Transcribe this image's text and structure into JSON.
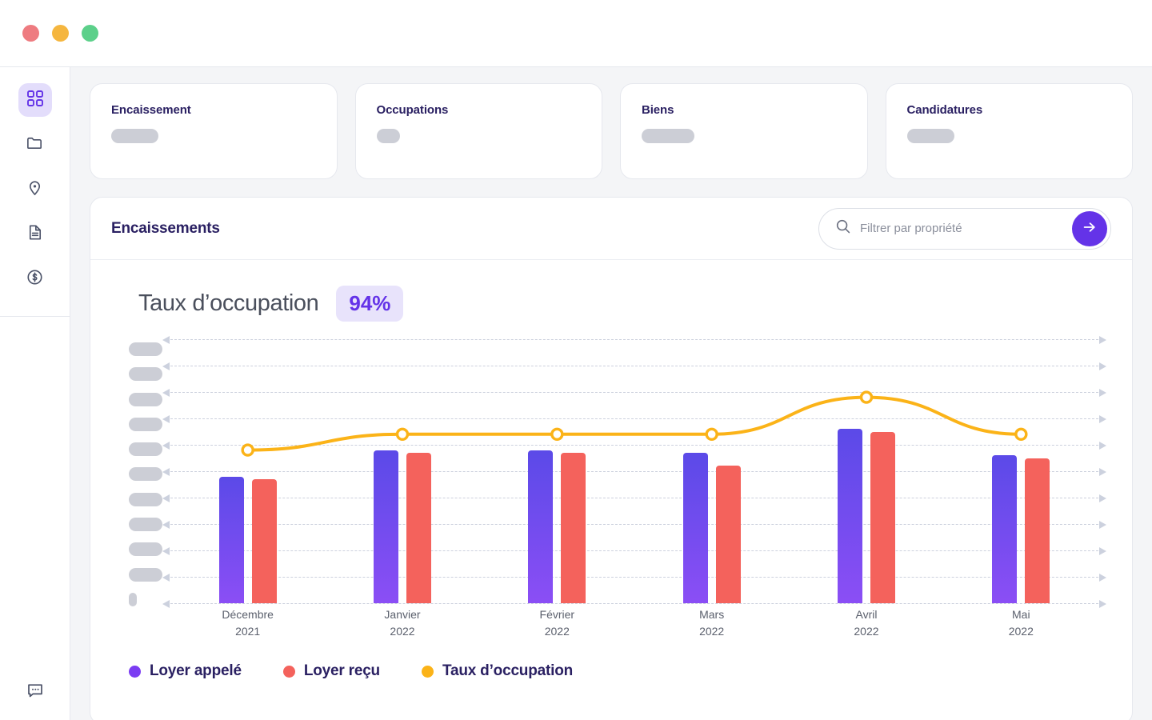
{
  "window": {
    "dots": [
      {
        "name": "close",
        "color": "#ee7b80"
      },
      {
        "name": "minimize",
        "color": "#f5b63f"
      },
      {
        "name": "maximize",
        "color": "#5cd08a"
      }
    ]
  },
  "sidebar": {
    "items": [
      {
        "icon": "dashboard-grid-icon",
        "active": true
      },
      {
        "icon": "folder-icon",
        "active": false
      },
      {
        "icon": "location-pin-icon",
        "active": false
      },
      {
        "icon": "document-icon",
        "active": false
      },
      {
        "icon": "dollar-circle-icon",
        "active": false
      }
    ],
    "footer": {
      "icon": "chat-bubble-icon"
    }
  },
  "kpi_cards": [
    {
      "title": "Encaissement",
      "skeleton_width": 59
    },
    {
      "title": "Occupations",
      "skeleton_width": 29
    },
    {
      "title": "Biens",
      "skeleton_width": 66
    },
    {
      "title": "Candidatures",
      "skeleton_width": 59
    }
  ],
  "panel": {
    "title": "Encaissements",
    "search": {
      "placeholder": "Filtrer par propriété",
      "value": "",
      "icon": "search-icon",
      "submit_icon": "arrow-right-icon",
      "accent": "#6433e8"
    }
  },
  "chart_header": {
    "label": "Taux d’occupation",
    "rate": "94%"
  },
  "legend": [
    {
      "label": "Loyer appelé",
      "color": "#7b3df2"
    },
    {
      "label": "Loyer reçu",
      "color": "#f4625c"
    },
    {
      "label": "Taux d’occupation",
      "color": "#fbb318"
    }
  ],
  "chart_data": {
    "type": "bar",
    "title": "Encaissements",
    "xlabel": "",
    "ylabel": "",
    "grid": true,
    "gridlines": 11,
    "legend_position": "bottom-left",
    "categories": [
      "Décembre",
      "Janvier",
      "Février",
      "Mars",
      "Avril",
      "Mai"
    ],
    "category_years": [
      "2021",
      "2022",
      "2022",
      "2022",
      "2022",
      "2022"
    ],
    "y_tick_labels_hidden": true,
    "y_tick_count": 11,
    "ylim": [
      0,
      100
    ],
    "series": [
      {
        "name": "Loyer appelé",
        "type": "bar",
        "color": "#7b3df2",
        "values": [
          48,
          58,
          58,
          57,
          66,
          56
        ]
      },
      {
        "name": "Loyer reçu",
        "type": "bar",
        "color": "#f4625c",
        "values": [
          47,
          57,
          57,
          52,
          65,
          55
        ]
      },
      {
        "name": "Taux d’occupation",
        "type": "line",
        "color": "#fbb318",
        "values": [
          58,
          64,
          64,
          64,
          78,
          64
        ]
      }
    ]
  }
}
